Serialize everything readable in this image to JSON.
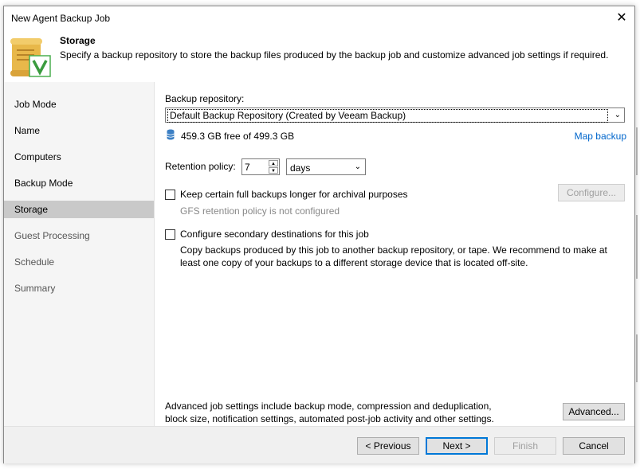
{
  "window": {
    "title": "New Agent Backup Job"
  },
  "header": {
    "title": "Storage",
    "description": "Specify a backup repository to store the backup files produced by the backup job and customize advanced job settings if required."
  },
  "sidebar": {
    "items": [
      {
        "label": "Job Mode"
      },
      {
        "label": "Name"
      },
      {
        "label": "Computers"
      },
      {
        "label": "Backup Mode"
      },
      {
        "label": "Storage"
      },
      {
        "label": "Guest Processing"
      },
      {
        "label": "Schedule"
      },
      {
        "label": "Summary"
      }
    ],
    "active_index": 4
  },
  "storage": {
    "repository_label": "Backup repository:",
    "repository_value": "Default Backup Repository (Created by Veeam Backup)",
    "free_space": "459.3 GB free of 499.3 GB",
    "map_backup_link": "Map backup",
    "retention_label": "Retention policy:",
    "retention_value": "7",
    "retention_unit": "days",
    "gfs_checkbox_label": "Keep certain full backups longer for archival purposes",
    "gfs_status": "GFS retention policy is not configured",
    "configure_button": "Configure...",
    "secondary_checkbox_label": "Configure secondary destinations for this job",
    "secondary_desc_line1": "Copy backups produced by this job to another backup repository, or tape. We recommend to make at",
    "secondary_desc_line2": "least one copy of your backups to a different storage device that is located off-site.",
    "advanced_desc_line1": "Advanced job settings include backup mode, compression and deduplication,",
    "advanced_desc_line2": "block size, notification settings, automated post-job activity and other settings.",
    "advanced_button": "Advanced..."
  },
  "footer": {
    "previous_button": "< Previous",
    "next_button": "Next >",
    "finish_button": "Finish",
    "cancel_button": "Cancel"
  },
  "colors": {
    "accent": "#0078d7",
    "link": "#0066cc",
    "active_nav": "#c9c9c9",
    "icon_gold": "#e8b84a",
    "icon_green": "#4caf50"
  }
}
